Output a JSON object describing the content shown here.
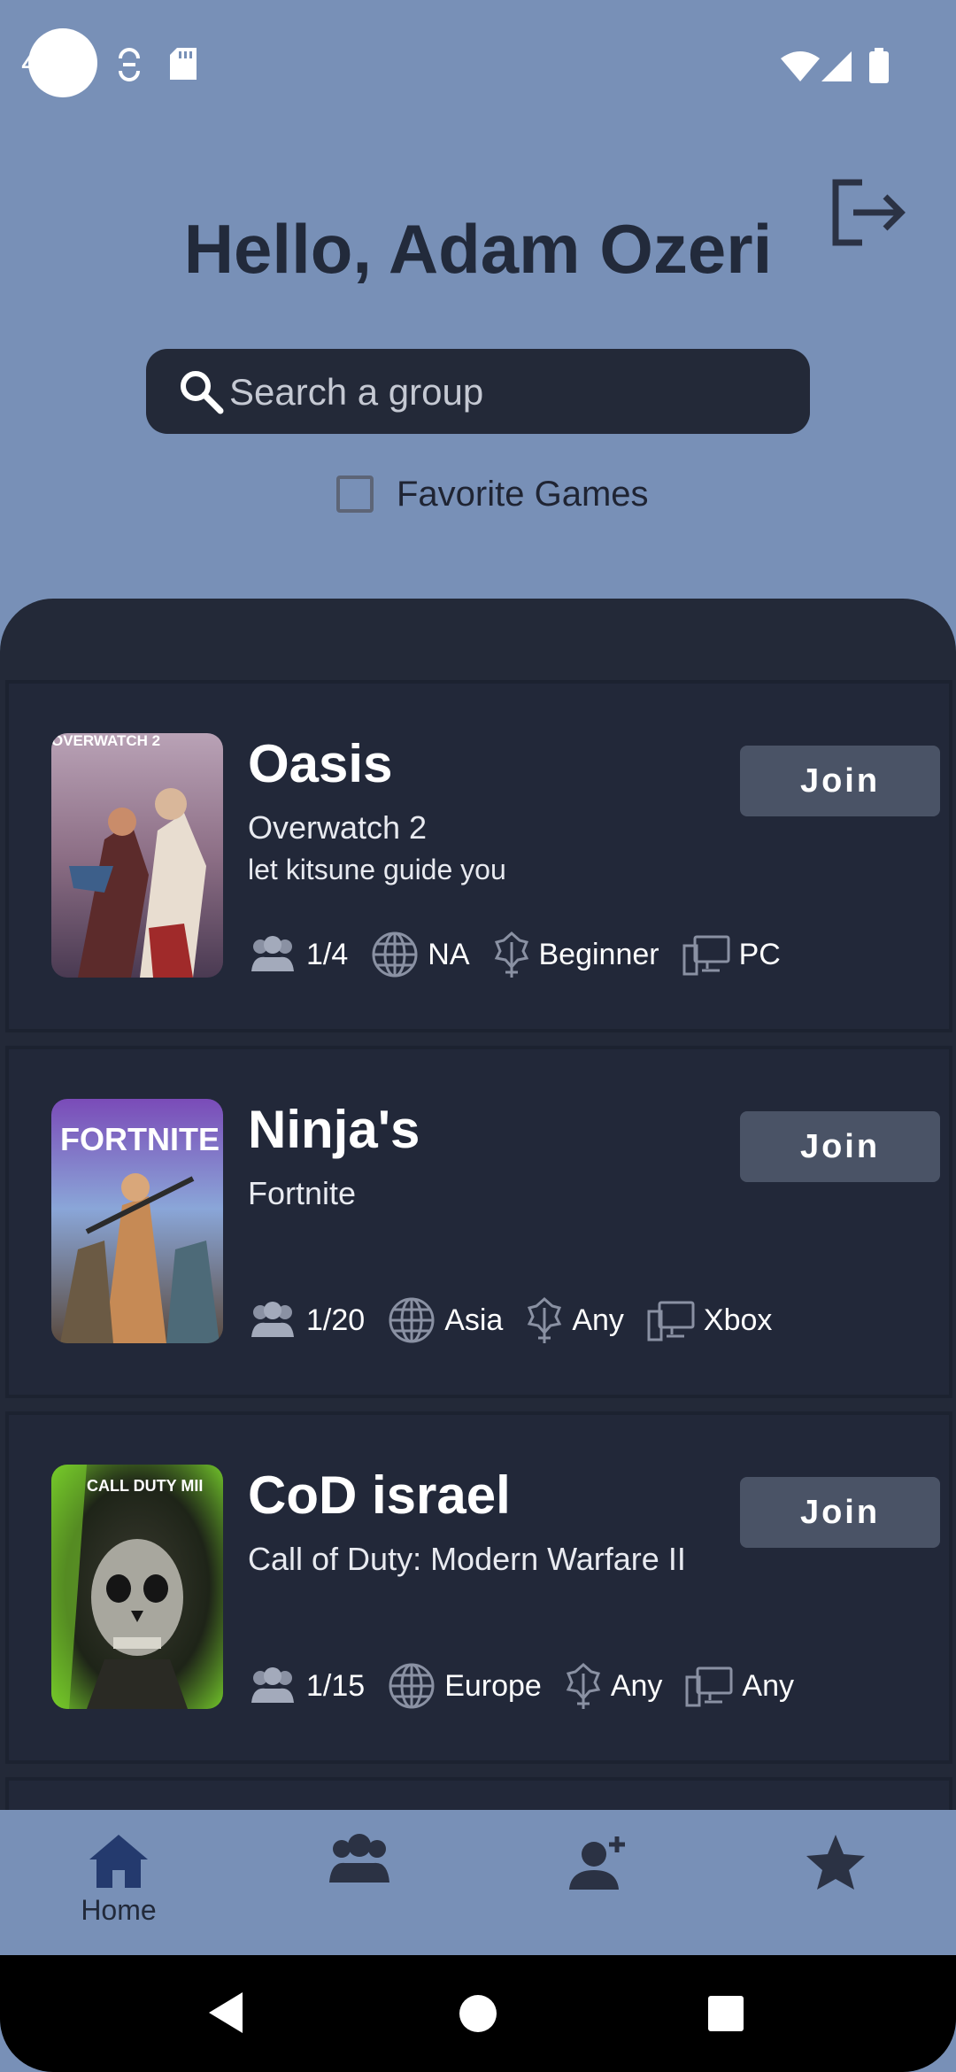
{
  "status_bar": {
    "left_text": "4"
  },
  "header": {
    "greeting": "Hello, Adam Ozeri",
    "search_placeholder": "Search a group",
    "favorite_label": "Favorite Games",
    "favorite_checked": false
  },
  "groups": [
    {
      "name": "Oasis",
      "game": "Overwatch 2",
      "description": "let kitsune guide you",
      "members": "1/4",
      "region": "NA",
      "skill": "Beginner",
      "platform": "PC",
      "join_label": "Join",
      "cover_text": "OVERWATCH 2"
    },
    {
      "name": "Ninja's",
      "game": "Fortnite",
      "description": "",
      "members": "1/20",
      "region": "Asia",
      "skill": "Any",
      "platform": "Xbox",
      "join_label": "Join",
      "cover_text": "FORTNITE"
    },
    {
      "name": "CoD israel",
      "game": "Call of Duty: Modern Warfare II",
      "description": "",
      "members": "1/15",
      "region": "Europe",
      "skill": "Any",
      "platform": "Any",
      "join_label": "Join",
      "cover_text": "CALL DUTY MII"
    }
  ],
  "bottom_nav": {
    "items": [
      {
        "label": "Home",
        "icon": "home-icon",
        "active": true
      },
      {
        "label": "",
        "icon": "groups-icon",
        "active": false
      },
      {
        "label": "",
        "icon": "add-friend-icon",
        "active": false
      },
      {
        "label": "",
        "icon": "star-icon",
        "active": false
      }
    ]
  },
  "colors": {
    "header_bg": "#7890b7",
    "panel_bg": "#232938",
    "join_button": "#4a5366",
    "text_dark": "#222a3b"
  }
}
